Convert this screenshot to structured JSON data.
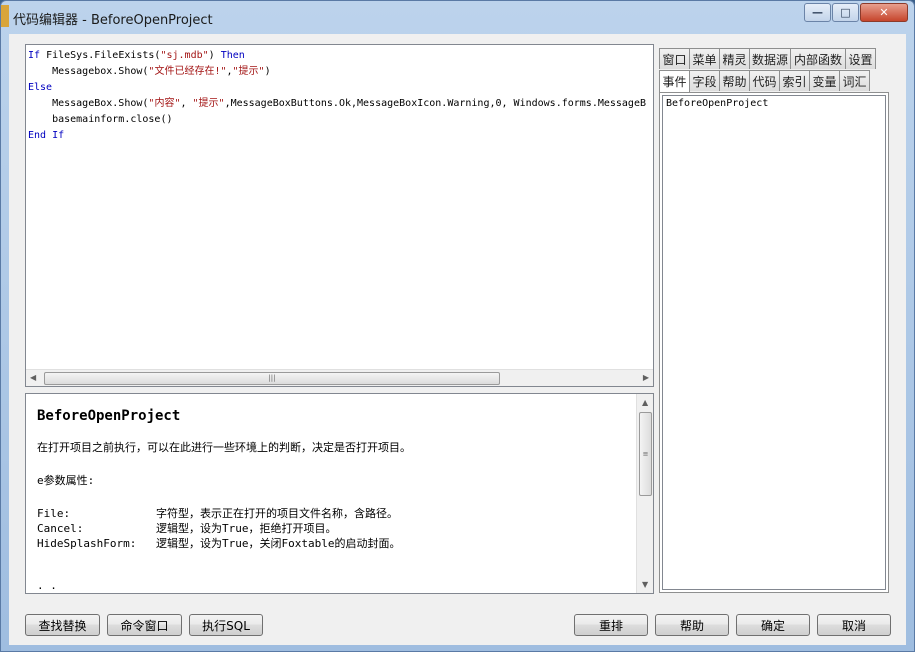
{
  "window": {
    "title": "代码编辑器 - BeforeOpenProject",
    "minimize_glyph": "—",
    "maximize_glyph": "□",
    "close_glyph": "✕"
  },
  "code": {
    "lines": [
      [
        {
          "t": "If",
          "c": "kw"
        },
        {
          "t": " FileSys.FileExists(",
          "c": ""
        },
        {
          "t": "\"sj.mdb\"",
          "c": "str"
        },
        {
          "t": ") ",
          "c": ""
        },
        {
          "t": "Then",
          "c": "kw"
        }
      ],
      [
        {
          "t": "    Messagebox.Show(",
          "c": ""
        },
        {
          "t": "\"文件已经存在!\"",
          "c": "str"
        },
        {
          "t": ",",
          "c": ""
        },
        {
          "t": "\"提示\"",
          "c": "str"
        },
        {
          "t": ")",
          "c": ""
        }
      ],
      [
        {
          "t": "Else",
          "c": "kw"
        }
      ],
      [
        {
          "t": "    MessageBox.Show(",
          "c": ""
        },
        {
          "t": "\"内容\"",
          "c": "str"
        },
        {
          "t": ", ",
          "c": ""
        },
        {
          "t": "\"提示\"",
          "c": "str"
        },
        {
          "t": ",MessageBoxButtons.Ok,MessageBoxIcon.Warning,0, Windows.forms.MessageB",
          "c": ""
        }
      ],
      [
        {
          "t": "    basemainform.close()",
          "c": ""
        }
      ],
      [
        {
          "t": "End If",
          "c": "kw"
        }
      ]
    ],
    "scroll_left_glyph": "◀",
    "scroll_right_glyph": "▶",
    "thumb_grip": "|||"
  },
  "help": {
    "title": "BeforeOpenProject",
    "description": "在打开项目之前执行，可以在此进行一些环境上的判断，决定是否打开项目。",
    "param_heading": "e参数属性:",
    "params": [
      {
        "name": "File:",
        "desc": "字符型，表示正在打开的项目文件名称，含路径。"
      },
      {
        "name": "Cancel:",
        "desc": "逻辑型，设为True，拒绝打开项目。"
      },
      {
        "name": "HideSplashForm:",
        "desc": "逻辑型，设为True，关闭Foxtable的启动封面。"
      }
    ],
    "trailing": "  · ·",
    "scroll_up_glyph": "▲",
    "scroll_down_glyph": "▼",
    "thumb_grip": "≡"
  },
  "tabs": {
    "row1": [
      "窗口",
      "菜单",
      "精灵",
      "数据源",
      "内部函数",
      "设置"
    ],
    "row2": [
      "事件",
      "字段",
      "帮助",
      "代码",
      "索引",
      "变量",
      "词汇"
    ],
    "active": "事件",
    "list_items": [
      "BeforeOpenProject"
    ]
  },
  "buttons": {
    "find_replace": "查找替换",
    "command_window": "命令窗口",
    "execute_sql": "执行SQL",
    "rearrange": "重排",
    "help": "帮助",
    "ok": "确定",
    "cancel": "取消"
  }
}
